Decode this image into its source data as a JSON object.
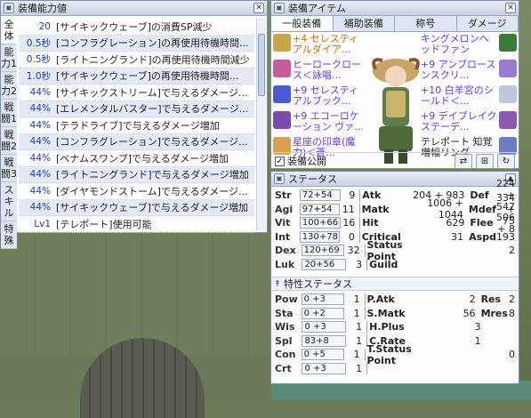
{
  "stats_window": {
    "title": "装備能力値",
    "side_tabs": [
      "全体",
      "能力1",
      "能力2",
      "戦闘1",
      "戦闘2",
      "戦闘3",
      "スキル",
      "特殊"
    ],
    "rows": [
      {
        "value": "20",
        "desc": "[サイキックウェーブ]の消費SP減少"
      },
      {
        "value": "0.5秒",
        "desc": "[コンフラグレーション]の再使用待機時間..."
      },
      {
        "value": "0.5秒",
        "desc": "[ライトニングランド]の再使用待機時間減少"
      },
      {
        "value": "1.0秒",
        "desc": "[サイキックウェーブ]の再使用待機時間..."
      },
      {
        "value": "44%",
        "desc": "[サイキックストリーム]で与えるダメージ..."
      },
      {
        "value": "44%",
        "desc": "[エレメンタルバスター]で与えるダメージ..."
      },
      {
        "value": "44%",
        "desc": "[テラドライブ]で与えるダメージ増加"
      },
      {
        "value": "44%",
        "desc": "[コンフラグレーション]で与えるダメージ..."
      },
      {
        "value": "44%",
        "desc": "[ベナムスワンプ]で与えるダメージ増加"
      },
      {
        "value": "44%",
        "desc": "[ライトニングランド]で与えるダメージ増加"
      },
      {
        "value": "44%",
        "desc": "[ダイヤモンドストーム]で与えるダメージ..."
      },
      {
        "value": "44%",
        "desc": "[サイキックウェーブ]で与えるダメージ増加"
      },
      {
        "value": "Lv1",
        "desc": "[テレポート]使用可能"
      }
    ]
  },
  "equip_window": {
    "title": "装備アイテム",
    "tabs": [
      "一般装備",
      "補助装備",
      "称号",
      "ダメージ"
    ],
    "slots_left": [
      {
        "text": "+4 セレスティアルダイア...",
        "color": "#d46a00"
      },
      {
        "text": "ヒーロークロース＜詠唱...",
        "color": "#6a38d6"
      },
      {
        "text": "+9 セレスティアルブック...",
        "color": "#6a38d6"
      },
      {
        "text": "+9 エコーロケーション ヴァ...",
        "color": "#6a38d6"
      },
      {
        "text": "星座の印章(魔力)＜蒼...",
        "color": "#6a38d6"
      }
    ],
    "slots_right": [
      {
        "text": "キングメロンヘッドファン",
        "color": "#6a38d6"
      },
      {
        "text": "+9 アンブロースンスクリ...",
        "color": "#6a38d6"
      },
      {
        "text": "+10 白羊宮のシールド＜...",
        "color": "#6a38d6"
      },
      {
        "text": "+9 デイブレイクステーデ...",
        "color": "#6a38d6"
      },
      {
        "text": "テレポート 知覚増幅リング",
        "color": "#222222"
      }
    ],
    "public_label": "装備公開",
    "public_checked": "✓"
  },
  "status_window": {
    "title": "ステータス",
    "base_stats": [
      {
        "name": "Str",
        "value": "72+54",
        "cost": "9"
      },
      {
        "name": "Agi",
        "value": "97+54",
        "cost": "11"
      },
      {
        "name": "Vit",
        "value": "100+66",
        "cost": "16"
      },
      {
        "name": "Int",
        "value": "130+78",
        "cost": "0"
      },
      {
        "name": "Dex",
        "value": "120+69",
        "cost": "32"
      },
      {
        "name": "Luk",
        "value": "20+56",
        "cost": "3"
      }
    ],
    "mid": [
      {
        "label": "Atk",
        "value": "204 + 983"
      },
      {
        "label": "Matk",
        "value": "1006 + 1044"
      },
      {
        "label": "Hit",
        "value": "629"
      },
      {
        "label": "Critical",
        "value": "31"
      },
      {
        "label": "Status Point",
        "value": ""
      },
      {
        "label": "Guild",
        "value": ""
      }
    ],
    "right": [
      {
        "label": "Def",
        "value": "224 + 547"
      },
      {
        "label": "Mdef",
        "value": "334 + 75"
      },
      {
        "label": "Flee",
        "value": "506 + 8"
      },
      {
        "label": "Aspd",
        "value": "193"
      },
      {
        "label": "",
        "value": "2"
      },
      {
        "label": "",
        "value": ""
      }
    ],
    "trait_title": "特性ステータス",
    "trait_stats": [
      {
        "name": "Pow",
        "value": "0 +3",
        "cost": "1"
      },
      {
        "name": "Sta",
        "value": "0 +2",
        "cost": "1"
      },
      {
        "name": "Wis",
        "value": "0 +3",
        "cost": "1"
      },
      {
        "name": "Spl",
        "value": "83+8",
        "cost": "1"
      },
      {
        "name": "Con",
        "value": "0 +5",
        "cost": "1"
      },
      {
        "name": "Crt",
        "value": "0 +3",
        "cost": "1"
      }
    ],
    "trait_mid": [
      {
        "label": "P.Atk",
        "value": "2"
      },
      {
        "label": "S.Matk",
        "value": "56"
      },
      {
        "label": "H.Plus",
        "value": "3"
      },
      {
        "label": "C.Rate",
        "value": "1"
      },
      {
        "label": "T.Status Point",
        "value": ""
      },
      {
        "label": "",
        "value": ""
      }
    ],
    "trait_right": [
      {
        "label": "Res",
        "value": "2"
      },
      {
        "label": "Mres",
        "value": "8"
      },
      {
        "label": "",
        "value": ""
      },
      {
        "label": "",
        "value": ""
      },
      {
        "label": "",
        "value": "0"
      },
      {
        "label": "",
        "value": ""
      }
    ]
  },
  "icons": {
    "tb_a": "▣",
    "close": "✕",
    "collapse": "▲",
    "trait_arrow": "⯭"
  }
}
